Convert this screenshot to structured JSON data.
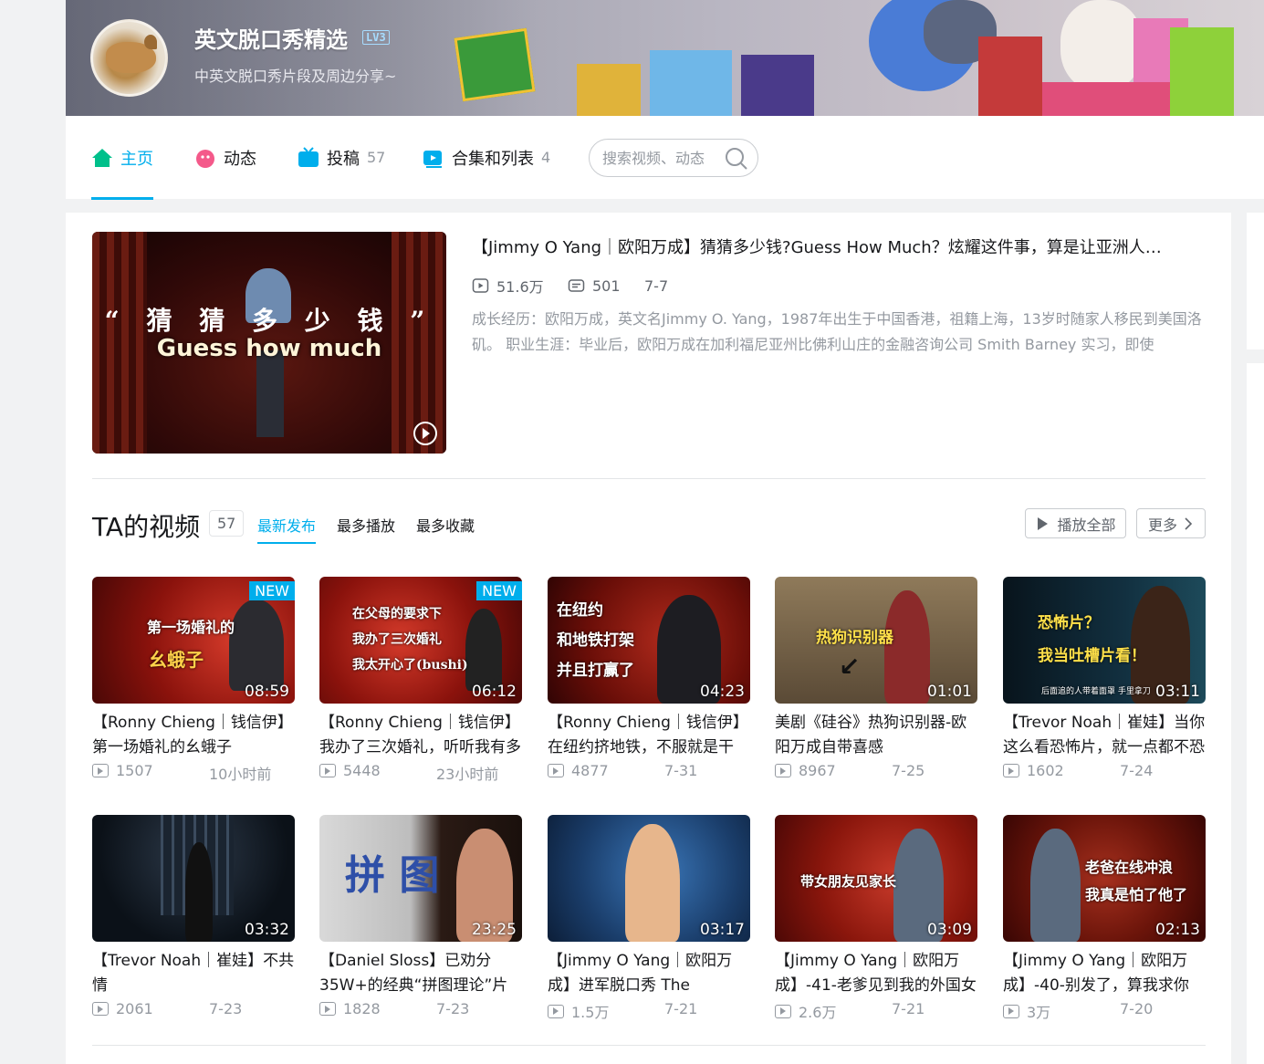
{
  "header": {
    "username": "英文脱口秀精选",
    "level_badge": "LV3",
    "signature": "中英文脱口秀片段及周边分享~"
  },
  "nav": {
    "items": [
      {
        "label": "主页",
        "count": "",
        "icon": "home-icon",
        "active": true
      },
      {
        "label": "动态",
        "count": "",
        "icon": "dynamic-icon"
      },
      {
        "label": "投稿",
        "count": "57",
        "icon": "upload-tv-icon"
      },
      {
        "label": "合集和列表",
        "count": "4",
        "icon": "collection-icon"
      }
    ],
    "search_placeholder": "搜索视频、动态"
  },
  "featured": {
    "title": "【Jimmy O Yang｜欧阳万成】猜猜多少钱?Guess How Much？炫耀这件事，算是让亚洲人…",
    "views": "51.6万",
    "comments": "501",
    "date": "7-7",
    "description": "成长经历：欧阳万成，英文名Jimmy O. Yang，1987年出生于中国香港，祖籍上海，13岁时随家人移民到美国洛矶。 职业生涯：毕业后，欧阳万成在加利福尼亚州比佛利山庄的金融咨询公司 Smith Barney 实习，即使",
    "thumb_caption_1": "“ 猜 猜 多 少 钱 ”",
    "thumb_caption_2": "Guess how much"
  },
  "videos_section": {
    "title": "TA的视频",
    "count": "57",
    "tabs": [
      "最新发布",
      "最多播放",
      "最多收藏"
    ],
    "play_all": "播放全部",
    "more": "更多"
  },
  "videos": [
    {
      "title": "【Ronny Chieng｜钱信伊】第一场婚礼的幺蛾子",
      "views": "1507",
      "date": "10小时前",
      "duration": "08:59",
      "badge": "NEW",
      "cap1": "第一场婚礼的",
      "cap2": "幺蛾子"
    },
    {
      "title": "【Ronny Chieng｜钱信伊】我办了三次婚礼，听听我有多",
      "views": "5448",
      "date": "23小时前",
      "duration": "06:12",
      "badge": "NEW",
      "cap1": "在父母的要求下",
      "cap2": "我办了三次婚礼",
      "cap3": "我太开心了(bushi)"
    },
    {
      "title": "【Ronny Chieng｜钱信伊】在纽约挤地铁，不服就是干",
      "views": "4877",
      "date": "7-31",
      "duration": "04:23",
      "badge": "",
      "cap1": "在纽约",
      "cap2": "和地铁打架",
      "cap3": "并且打赢了"
    },
    {
      "title": "美剧《硅谷》热狗识别器-欧阳万成自带喜感",
      "views": "8967",
      "date": "7-25",
      "duration": "01:01",
      "badge": "",
      "cap1": "热狗识别器"
    },
    {
      "title": "【Trevor Noah｜崔娃】当你这么看恐怖片，就一点都不恐",
      "views": "1602",
      "date": "7-24",
      "duration": "03:11",
      "badge": "",
      "cap1": "恐怖片？",
      "cap2": "我当吐槽片看！",
      "cap3": "后面追的人带着面罩 手里拿刀"
    },
    {
      "title": "【Trevor Noah｜崔娃】不共情",
      "views": "2061",
      "date": "7-23",
      "duration": "03:32",
      "badge": ""
    },
    {
      "title": "【Daniel Sloss】已劝分35W+的经典“拼图理论”片",
      "views": "1828",
      "date": "7-23",
      "duration": "23:25",
      "badge": "",
      "cap1": "拼 图"
    },
    {
      "title": "【Jimmy O Yang｜欧阳万成】进军脱口秀 The",
      "views": "1.5万",
      "date": "7-21",
      "duration": "03:17",
      "badge": ""
    },
    {
      "title": "【Jimmy O Yang｜欧阳万成】-41-老爹见到我的外国女",
      "views": "2.6万",
      "date": "7-21",
      "duration": "03:09",
      "badge": "",
      "cap1": "带女朋友见家长"
    },
    {
      "title": "【Jimmy O Yang｜欧阳万成】-40-别发了，算我求你",
      "views": "3万",
      "date": "7-20",
      "duration": "02:13",
      "badge": "",
      "cap1": "老爸在线冲浪",
      "cap2": "我真是怕了他了"
    }
  ],
  "colors": {
    "accent": "#00aeec",
    "text": "#18191c",
    "muted": "#9499a0"
  }
}
